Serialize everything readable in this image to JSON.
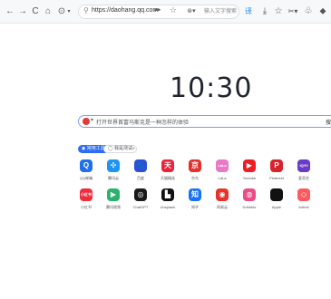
{
  "browser": {
    "back_glyph": "←",
    "forward_glyph": "→",
    "reload_glyph": "C",
    "home_glyph": "⌂",
    "history_glyph": "⊙",
    "history_caret": "▾",
    "url": "https://daohang.qq.com",
    "share_glyph": "⮫",
    "star_glyph": "☆",
    "search_mode": "⊛▾",
    "search_hint": "输入文字搜索",
    "translate_glyph": "译",
    "download_glyph": "⤓",
    "favorite_glyph": "☆",
    "cut_glyph": "✂▾",
    "extension_glyph": "♧",
    "more_glyph": "⬥"
  },
  "clock": "10:30",
  "search": {
    "placeholder": "打开世界首富马斯克是一种怎样的体验",
    "button": "搜索"
  },
  "tabs": {
    "active": "◉ 常用工具",
    "secondary": "◯ 我是测试",
    "add": "+"
  },
  "shortcuts": [
    {
      "label": "QQ邮箱",
      "glyph": "Q",
      "color": "#1e6fe8"
    },
    {
      "label": "腾讯云",
      "glyph": "✣",
      "color": "#2094f3"
    },
    {
      "label": "百度",
      "glyph": "🐾",
      "color": "#2b51d6"
    },
    {
      "label": "天猫精选",
      "glyph": "天",
      "color": "#e8233a"
    },
    {
      "label": "京东",
      "glyph": "京",
      "color": "#e3302d"
    },
    {
      "label": "LaLa",
      "glyph": "LaLa",
      "color": "#e879c6"
    },
    {
      "label": "Youtube",
      "glyph": "▶",
      "color": "#ec1d25"
    },
    {
      "label": "Pinterest",
      "glyph": "P",
      "color": "#d8232a"
    },
    {
      "label": "爱奇艺",
      "glyph": "iQIYI",
      "color": "#6a3cc6"
    },
    {
      "label": "小红书",
      "glyph": "小红书",
      "color": "#ef2c3c"
    },
    {
      "label": "腾讯视频",
      "glyph": "▶",
      "color": "#2bb36d"
    },
    {
      "label": "ChatGPT",
      "glyph": "◎",
      "color": "#1a1a1a"
    },
    {
      "label": "Unsplash",
      "glyph": "▙",
      "color": "#111111"
    },
    {
      "label": "知乎",
      "glyph": "知",
      "color": "#1772f6"
    },
    {
      "label": "网易云",
      "glyph": "◉",
      "color": "#e4342d"
    },
    {
      "label": "Dribbble",
      "glyph": "◍",
      "color": "#ea4c89"
    },
    {
      "label": "Apple",
      "glyph": "",
      "color": "#111111"
    },
    {
      "label": "Airbnb",
      "glyph": "◇",
      "color": "#ff5a5f"
    }
  ]
}
